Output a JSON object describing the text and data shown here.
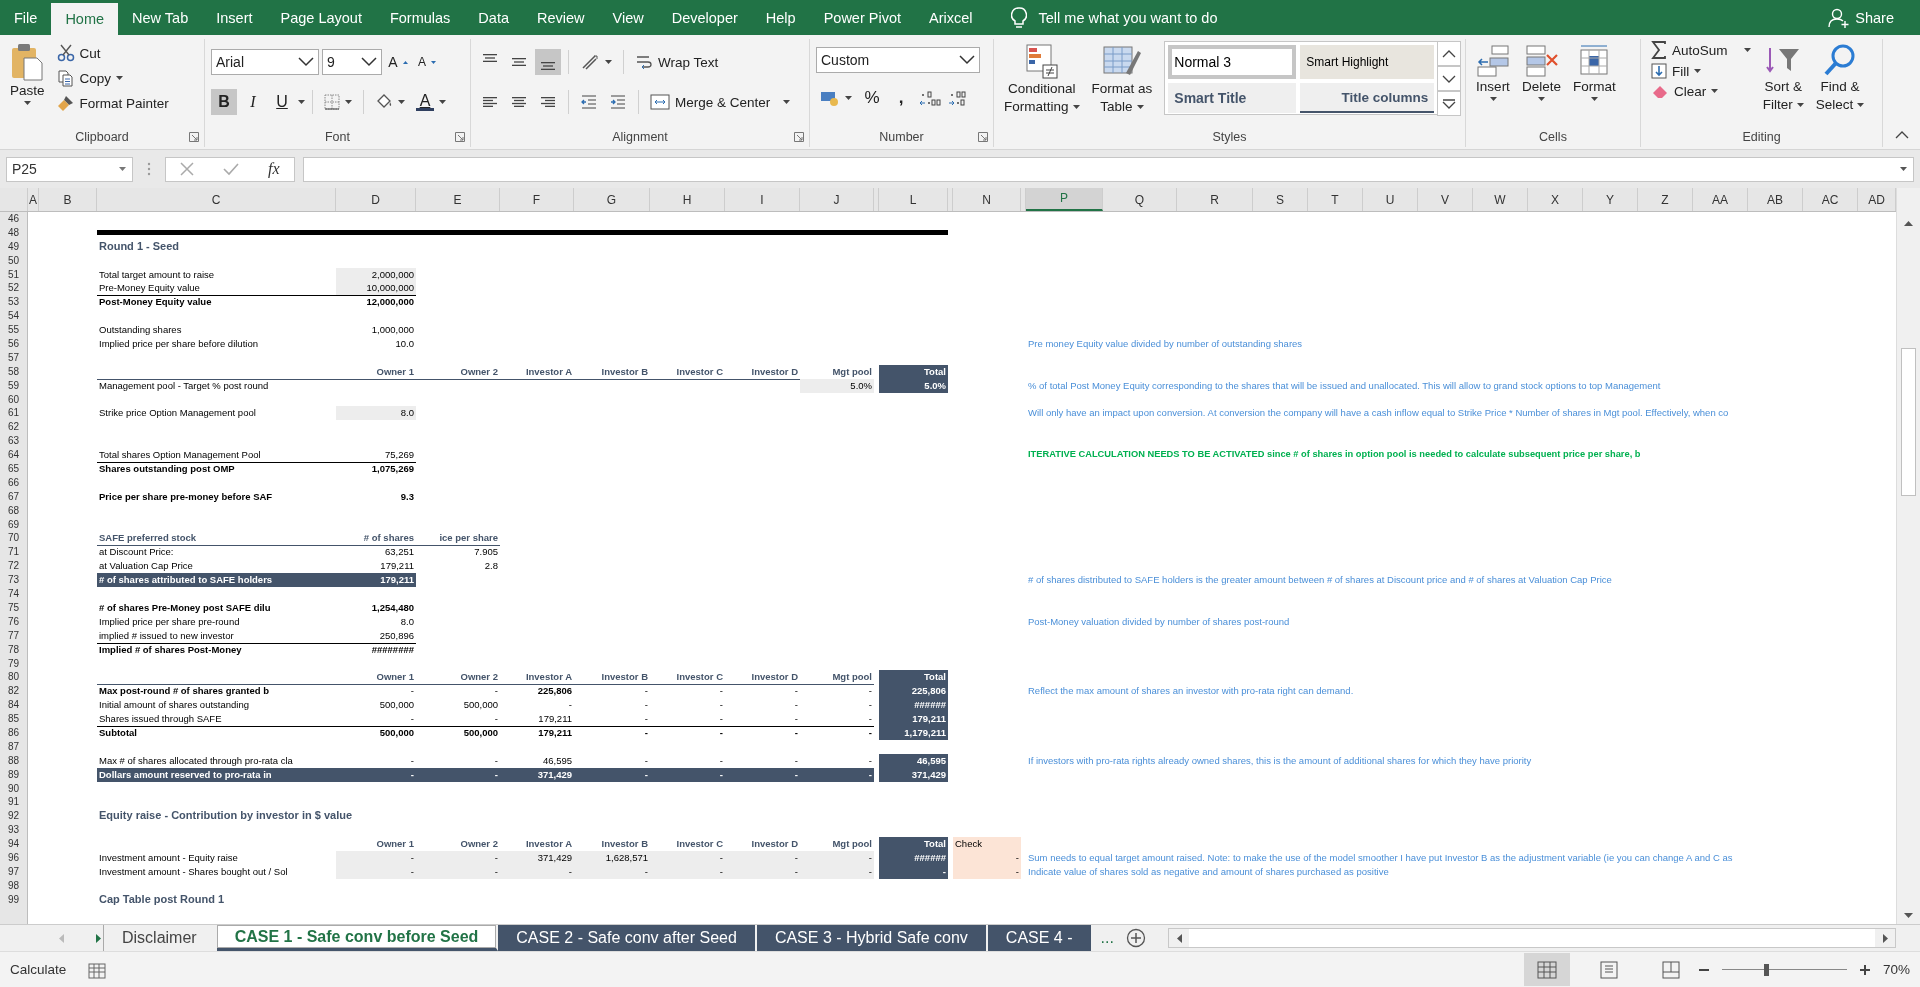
{
  "ribbon": {
    "tabs": [
      {
        "label": "File",
        "selected": false
      },
      {
        "label": "Home",
        "selected": true
      },
      {
        "label": "New Tab",
        "selected": false
      },
      {
        "label": "Insert",
        "selected": false
      },
      {
        "label": "Page Layout",
        "selected": false
      },
      {
        "label": "Formulas",
        "selected": false
      },
      {
        "label": "Data",
        "selected": false
      },
      {
        "label": "Review",
        "selected": false
      },
      {
        "label": "View",
        "selected": false
      },
      {
        "label": "Developer",
        "selected": false
      },
      {
        "label": "Help",
        "selected": false
      },
      {
        "label": "Power Pivot",
        "selected": false
      },
      {
        "label": "Arixcel",
        "selected": false
      }
    ],
    "tell_me": "Tell me what you want to do",
    "share": "Share",
    "clipboard": {
      "label": "Clipboard",
      "paste": "Paste",
      "cut": "Cut",
      "copy": "Copy",
      "format_painter": "Format Painter"
    },
    "font": {
      "label": "Font",
      "name": "Arial",
      "size": "9",
      "grow": "A",
      "shrink": "A",
      "bold": {
        "glyph": "B",
        "pressed": true
      },
      "italic": {
        "glyph": "I",
        "pressed": false
      },
      "underline": {
        "glyph": "U",
        "pressed": false
      },
      "font_color": "A"
    },
    "alignment": {
      "label": "Alignment",
      "vertical": [
        {
          "kind": "top",
          "selected": false
        },
        {
          "kind": "middle",
          "selected": false
        },
        {
          "kind": "bottom",
          "selected": true
        }
      ],
      "horizontal": [
        {
          "kind": "left",
          "selected": false
        },
        {
          "kind": "center",
          "selected": false
        },
        {
          "kind": "right",
          "selected": false
        }
      ],
      "wrap_text": "Wrap Text",
      "merge": "Merge & Center"
    },
    "number": {
      "label": "Number",
      "format": "Custom",
      "percent": "%",
      "comma": ","
    },
    "styles": {
      "label": "Styles",
      "conditional": [
        "Conditional",
        "Formatting"
      ],
      "format_table": [
        "Format as",
        "Table"
      ],
      "gallery": [
        {
          "kind": "normal",
          "label": "Normal 3",
          "selected": true
        },
        {
          "kind": "highlight",
          "label": "Smart Highlight",
          "selected": false
        },
        {
          "kind": "title",
          "label": "Smart Title",
          "selected": false
        },
        {
          "kind": "columns",
          "label": "Title columns",
          "selected": false
        }
      ]
    },
    "cells": {
      "label": "Cells",
      "buttons": [
        "Insert",
        "Delete",
        "Format"
      ]
    },
    "editing": {
      "label": "Editing",
      "autosum": "AutoSum",
      "fill": "Fill",
      "clear": "Clear",
      "sort": [
        "Sort &",
        "Filter"
      ],
      "find": [
        "Find &",
        "Select"
      ]
    }
  },
  "formula_bar": {
    "name_box": "P25",
    "function_label": "fx"
  },
  "sheet": {
    "columns": [
      {
        "label": "A",
        "selected": false
      },
      {
        "label": "B",
        "selected": false
      },
      {
        "label": "C",
        "selected": false
      },
      {
        "label": "D",
        "selected": false
      },
      {
        "label": "E",
        "selected": false
      },
      {
        "label": "F",
        "selected": false
      },
      {
        "label": "G",
        "selected": false
      },
      {
        "label": "H",
        "selected": false
      },
      {
        "label": "I",
        "selected": false
      },
      {
        "label": "J",
        "selected": false
      },
      {
        "selected": false
      },
      {
        "label": "L",
        "selected": false
      },
      {
        "selected": false
      },
      {
        "label": "N",
        "selected": false
      },
      {
        "selected": false
      },
      {
        "label": "P",
        "selected": true
      },
      {
        "label": "Q",
        "selected": false
      },
      {
        "label": "R",
        "selected": false
      },
      {
        "label": "S",
        "selected": false
      },
      {
        "label": "T",
        "selected": false
      },
      {
        "label": "U",
        "selected": false
      },
      {
        "label": "V",
        "selected": false
      },
      {
        "label": "W",
        "selected": false
      },
      {
        "label": "X",
        "selected": false
      },
      {
        "label": "Y",
        "selected": false
      },
      {
        "label": "Z",
        "selected": false
      },
      {
        "label": "AA",
        "selected": false
      },
      {
        "label": "AB",
        "selected": false
      },
      {
        "label": "AC",
        "selected": false
      },
      {
        "label": "AD",
        "selected": false
      }
    ],
    "rows": [
      {
        "n": "46"
      },
      {
        "n": "48",
        "kind": "section_break"
      },
      {
        "n": "49",
        "cells": [
          "",
          "",
          {
            "text": "Round 1 - Seed",
            "kind": "title"
          }
        ]
      },
      {
        "n": "50"
      },
      {
        "n": "51",
        "cells": [
          "",
          "",
          {
            "text": "Total target amount to raise",
            "kind": "plain"
          },
          {
            "text": "2,000,000",
            "kind": "input"
          }
        ]
      },
      {
        "n": "52",
        "cells": [
          "",
          "",
          {
            "text": "Pre-Money Equity value",
            "kind": "plain"
          },
          {
            "text": "10,000,000",
            "kind": "input"
          }
        ]
      },
      {
        "n": "53",
        "kind": "sum",
        "cells": [
          "",
          "",
          {
            "text": "Post-Money Equity value",
            "kind": "bold"
          },
          {
            "text": "12,000,000",
            "kind": "bold"
          }
        ]
      },
      {
        "n": "54"
      },
      {
        "n": "55",
        "cells": [
          "",
          "",
          {
            "text": "Outstanding shares",
            "kind": "plain"
          },
          {
            "text": "1,000,000",
            "kind": "plain"
          }
        ]
      },
      {
        "n": "56",
        "cells": [
          "",
          "",
          {
            "text": "Implied price per share before dilution",
            "kind": "plain"
          },
          {
            "text": "10.0",
            "kind": "plain"
          },
          "",
          "",
          "",
          "",
          "",
          "",
          "",
          "",
          "",
          "",
          "",
          {
            "text": "Pre money Equity value divided by number of outstanding shares",
            "kind": "note"
          }
        ]
      },
      {
        "n": "57"
      },
      {
        "n": "58",
        "cells": [
          "",
          "",
          "",
          {
            "text": "Owner 1",
            "kind": "header"
          },
          {
            "text": "Owner 2",
            "kind": "header"
          },
          {
            "text": "Investor A",
            "kind": "header"
          },
          {
            "text": "Investor B",
            "kind": "header"
          },
          {
            "text": "Investor C",
            "kind": "header"
          },
          {
            "text": "Investor D",
            "kind": "header"
          },
          {
            "text": "Mgt pool",
            "kind": "header"
          },
          "",
          {
            "text": "Total",
            "kind": "total"
          }
        ]
      },
      {
        "n": "59",
        "kind": "under_header",
        "cells": [
          "",
          "",
          {
            "text": "Management pool - Target % post round",
            "kind": "plain"
          },
          "",
          "",
          "",
          "",
          "",
          "",
          {
            "text": "5.0%",
            "kind": "input"
          },
          "",
          {
            "text": "5.0%",
            "kind": "total"
          },
          "",
          "",
          "",
          {
            "text": "% of total Post Money Equity corresponding to the shares that will be issued and unallocated. This will allow to grand stock options to top Management",
            "kind": "note"
          }
        ]
      },
      {
        "n": "60"
      },
      {
        "n": "61",
        "cells": [
          "",
          "",
          {
            "text": "Strike price Option Management pool",
            "kind": "plain"
          },
          {
            "text": "8.0",
            "kind": "input"
          },
          "",
          "",
          "",
          "",
          "",
          "",
          "",
          "",
          "",
          "",
          "",
          {
            "text": "Will only have an impact upon conversion. At conversion the company will have a cash inflow equal to Strike Price * Number of shares in Mgt pool. Effectively, when co",
            "kind": "note"
          }
        ]
      },
      {
        "n": "62"
      },
      {
        "n": "63"
      },
      {
        "n": "64",
        "cells": [
          "",
          "",
          {
            "text": "Total shares Option Management Pool",
            "kind": "plain"
          },
          {
            "text": "75,269",
            "kind": "plain"
          },
          "",
          "",
          "",
          "",
          "",
          "",
          "",
          "",
          "",
          "",
          "",
          {
            "text": "ITERATIVE CALCULATION NEEDS TO BE ACTIVATED since # of shares in option pool is needed to calculate subsequent price per share, b",
            "kind": "alert"
          }
        ]
      },
      {
        "n": "65",
        "kind": "sum",
        "cells": [
          "",
          "",
          {
            "text": "Shares outstanding post OMP",
            "kind": "bold"
          },
          {
            "text": "1,075,269",
            "kind": "bold"
          }
        ]
      },
      {
        "n": "66"
      },
      {
        "n": "67",
        "cells": [
          "",
          "",
          {
            "text": "Price per share pre-money before SAF",
            "kind": "bold"
          },
          {
            "text": "9.3",
            "kind": "bold"
          }
        ]
      },
      {
        "n": "68"
      },
      {
        "n": "69"
      },
      {
        "n": "70",
        "cells": [
          "",
          "",
          {
            "text": "SAFE preferred stock",
            "kind": "header"
          },
          {
            "text": "# of shares",
            "kind": "header"
          },
          {
            "text": "ice per share",
            "kind": "header"
          }
        ]
      },
      {
        "n": "71",
        "kind": "under_header",
        "cells": [
          "",
          "",
          {
            "text": "at Discount Price:",
            "kind": "plain"
          },
          {
            "text": "63,251",
            "kind": "plain"
          },
          {
            "text": "7.905",
            "kind": "plain"
          }
        ]
      },
      {
        "n": "72",
        "cells": [
          "",
          "",
          {
            "text": "at Valuation Cap Price",
            "kind": "plain"
          },
          {
            "text": "179,211",
            "kind": "plain"
          },
          {
            "text": "2.8",
            "kind": "plain"
          }
        ]
      },
      {
        "n": "73",
        "cells": [
          "",
          "",
          {
            "text": "# of shares attributed to SAFE holders",
            "kind": "total"
          },
          {
            "text": "179,211",
            "kind": "total"
          },
          "",
          "",
          "",
          "",
          "",
          "",
          "",
          "",
          "",
          "",
          "",
          {
            "text": "# of shares distributed to SAFE holders is the greater amount between # of shares at Discount price and # of shares at Valuation Cap Price",
            "kind": "note"
          }
        ]
      },
      {
        "n": "74"
      },
      {
        "n": "75",
        "cells": [
          "",
          "",
          {
            "text": "# of shares Pre-Money post SAFE dilu",
            "kind": "bold"
          },
          {
            "text": "1,254,480",
            "kind": "bold"
          }
        ]
      },
      {
        "n": "76",
        "cells": [
          "",
          "",
          {
            "text": "Implied price per share pre-round",
            "kind": "plain"
          },
          {
            "text": "8.0",
            "kind": "plain"
          },
          "",
          "",
          "",
          "",
          "",
          "",
          "",
          "",
          "",
          "",
          "",
          {
            "text": "Post-Money valuation divided by number of shares post-round",
            "kind": "note"
          }
        ]
      },
      {
        "n": "77",
        "cells": [
          "",
          "",
          {
            "text": "implied # issued to new investor",
            "kind": "plain"
          },
          {
            "text": "250,896",
            "kind": "plain"
          }
        ]
      },
      {
        "n": "78",
        "kind": "sum",
        "cells": [
          "",
          "",
          {
            "text": "Implied # of shares Post-Money",
            "kind": "bold"
          },
          {
            "text": "########",
            "kind": "bold"
          }
        ]
      },
      {
        "n": "79"
      },
      {
        "n": "80",
        "cells": [
          "",
          "",
          "",
          {
            "text": "Owner 1",
            "kind": "header"
          },
          {
            "text": "Owner 2",
            "kind": "header"
          },
          {
            "text": "Investor A",
            "kind": "header"
          },
          {
            "text": "Investor B",
            "kind": "header"
          },
          {
            "text": "Investor C",
            "kind": "header"
          },
          {
            "text": "Investor D",
            "kind": "header"
          },
          {
            "text": "Mgt pool",
            "kind": "header"
          },
          "",
          {
            "text": "Total",
            "kind": "total"
          }
        ]
      },
      {
        "n": "82",
        "kind": "under_header",
        "cells": [
          "",
          "",
          {
            "text": "Max post-round # of shares granted b",
            "kind": "bold"
          },
          {
            "text": "-",
            "kind": "plain"
          },
          {
            "text": "-",
            "kind": "plain"
          },
          {
            "text": "225,806",
            "kind": "bold"
          },
          {
            "text": "-",
            "kind": "plain"
          },
          {
            "text": "-",
            "kind": "plain"
          },
          {
            "text": "-",
            "kind": "plain"
          },
          {
            "text": "-",
            "kind": "plain"
          },
          "",
          {
            "text": "225,806",
            "kind": "total"
          },
          "",
          "",
          "",
          {
            "text": "Reflect the max amount of shares an investor with pro-rata right can demand.",
            "kind": "note"
          }
        ]
      },
      {
        "n": "84",
        "cells": [
          "",
          "",
          {
            "text": "Initial amount of shares outstanding",
            "kind": "plain"
          },
          {
            "text": "500,000",
            "kind": "plain"
          },
          {
            "text": "500,000",
            "kind": "plain"
          },
          {
            "text": "-",
            "kind": "plain"
          },
          {
            "text": "-",
            "kind": "plain"
          },
          {
            "text": "-",
            "kind": "plain"
          },
          {
            "text": "-",
            "kind": "plain"
          },
          {
            "text": "-",
            "kind": "plain"
          },
          "",
          {
            "text": "######",
            "kind": "total"
          }
        ]
      },
      {
        "n": "85",
        "cells": [
          "",
          "",
          {
            "text": "Shares issued through SAFE",
            "kind": "plain"
          },
          {
            "text": "-",
            "kind": "plain"
          },
          {
            "text": "-",
            "kind": "plain"
          },
          {
            "text": "179,211",
            "kind": "plain"
          },
          {
            "text": "-",
            "kind": "plain"
          },
          {
            "text": "-",
            "kind": "plain"
          },
          {
            "text": "-",
            "kind": "plain"
          },
          {
            "text": "-",
            "kind": "plain"
          },
          "",
          {
            "text": "179,211",
            "kind": "total"
          }
        ]
      },
      {
        "n": "86",
        "kind": "sum",
        "cells": [
          "",
          "",
          {
            "text": "Subtotal",
            "kind": "bold"
          },
          {
            "text": "500,000",
            "kind": "bold"
          },
          {
            "text": "500,000",
            "kind": "bold"
          },
          {
            "text": "179,211",
            "kind": "bold"
          },
          {
            "text": "-",
            "kind": "bold"
          },
          {
            "text": "-",
            "kind": "bold"
          },
          {
            "text": "-",
            "kind": "bold"
          },
          {
            "text": "-",
            "kind": "bold"
          },
          "",
          {
            "text": "1,179,211",
            "kind": "total"
          }
        ]
      },
      {
        "n": "87"
      },
      {
        "n": "88",
        "cells": [
          "",
          "",
          {
            "text": "Max # of shares allocated through pro-rata cla",
            "kind": "plain"
          },
          {
            "text": "-",
            "kind": "plain"
          },
          {
            "text": "-",
            "kind": "plain"
          },
          {
            "text": "46,595",
            "kind": "plain"
          },
          {
            "text": "-",
            "kind": "plain"
          },
          {
            "text": "-",
            "kind": "plain"
          },
          {
            "text": "-",
            "kind": "plain"
          },
          {
            "text": "-",
            "kind": "plain"
          },
          "",
          {
            "text": "46,595",
            "kind": "total"
          },
          "",
          "",
          "",
          {
            "text": "If investors with pro-rata rights already owned shares, this is the amount of additional shares for which they have priority",
            "kind": "note"
          }
        ]
      },
      {
        "n": "89",
        "cells": [
          "",
          "",
          {
            "text": "Dollars amount reserved to pro-rata in",
            "kind": "total"
          },
          {
            "text": "-",
            "kind": "total"
          },
          {
            "text": "-",
            "kind": "total"
          },
          {
            "text": "371,429",
            "kind": "total"
          },
          {
            "text": "-",
            "kind": "total"
          },
          {
            "text": "-",
            "kind": "total"
          },
          {
            "text": "-",
            "kind": "total"
          },
          {
            "text": "-",
            "kind": "total"
          },
          "",
          {
            "text": "371,429",
            "kind": "total"
          }
        ]
      },
      {
        "n": "90"
      },
      {
        "n": "91"
      },
      {
        "n": "92",
        "cells": [
          "",
          "",
          {
            "text": "Equity raise - Contribution by investor in $ value",
            "kind": "title"
          }
        ]
      },
      {
        "n": "93"
      },
      {
        "n": "94",
        "cells": [
          "",
          "",
          "",
          {
            "text": "Owner 1",
            "kind": "header"
          },
          {
            "text": "Owner 2",
            "kind": "header"
          },
          {
            "text": "Investor A",
            "kind": "header"
          },
          {
            "text": "Investor B",
            "kind": "header"
          },
          {
            "text": "Investor C",
            "kind": "header"
          },
          {
            "text": "Investor D",
            "kind": "header"
          },
          {
            "text": "Mgt pool",
            "kind": "header"
          },
          "",
          {
            "text": "Total",
            "kind": "total"
          },
          "",
          {
            "text": "Check",
            "kind": "check_header"
          }
        ]
      },
      {
        "n": "96",
        "cells": [
          "",
          "",
          {
            "text": "Investment amount - Equity raise",
            "kind": "plain"
          },
          {
            "text": "-",
            "kind": "input"
          },
          {
            "text": "-",
            "kind": "input"
          },
          {
            "text": "371,429",
            "kind": "input"
          },
          {
            "text": "1,628,571",
            "kind": "input"
          },
          {
            "text": "-",
            "kind": "input"
          },
          {
            "text": "-",
            "kind": "input"
          },
          {
            "text": "-",
            "kind": "input"
          },
          "",
          {
            "text": "######",
            "kind": "total"
          },
          "",
          {
            "text": "-",
            "kind": "check"
          },
          "",
          {
            "text": "Sum needs to equal target amount raised. Note: to make the use of the model smoother I have put Investor B as the adjustment variable (ie you can change A and C as",
            "kind": "note"
          }
        ]
      },
      {
        "n": "97",
        "cells": [
          "",
          "",
          {
            "text": "Investment amount - Shares bought out / Sol",
            "kind": "plain"
          },
          {
            "text": "-",
            "kind": "input"
          },
          {
            "text": "-",
            "kind": "input"
          },
          {
            "text": "-",
            "kind": "input"
          },
          {
            "text": "-",
            "kind": "input"
          },
          {
            "text": "-",
            "kind": "input"
          },
          {
            "text": "-",
            "kind": "input"
          },
          {
            "text": "-",
            "kind": "input"
          },
          "",
          {
            "text": "-",
            "kind": "total"
          },
          "",
          {
            "text": "-",
            "kind": "check"
          },
          "",
          {
            "text": "Indicate value of shares sold as negative and amount of shares purchased as positive",
            "kind": "note"
          }
        ]
      },
      {
        "n": "98"
      },
      {
        "n": "99",
        "cells": [
          "",
          "",
          {
            "text": "Cap Table post Round 1",
            "kind": "title"
          }
        ]
      }
    ]
  },
  "sheet_tabs": {
    "tabs": [
      {
        "label": "Disclaimer",
        "selected": false
      },
      {
        "label": "CASE 1 - Safe conv before Seed",
        "selected": true,
        "color": "#44546a"
      },
      {
        "label": "CASE 2 - Safe conv after Seed",
        "selected": false,
        "color": "#44546a"
      },
      {
        "label": "CASE 3 - Hybrid Safe conv",
        "selected": false,
        "color": "#44546a"
      },
      {
        "label": "CASE 4 -",
        "selected": false,
        "color": "#44546a"
      }
    ],
    "more": "..."
  },
  "status_bar": {
    "mode": "Calculate",
    "views": [
      {
        "kind": "normal",
        "selected": true
      },
      {
        "kind": "page_layout",
        "selected": false
      },
      {
        "kind": "page_break",
        "selected": false
      }
    ],
    "zoom": {
      "level": 0.35,
      "reading": "70%"
    }
  }
}
